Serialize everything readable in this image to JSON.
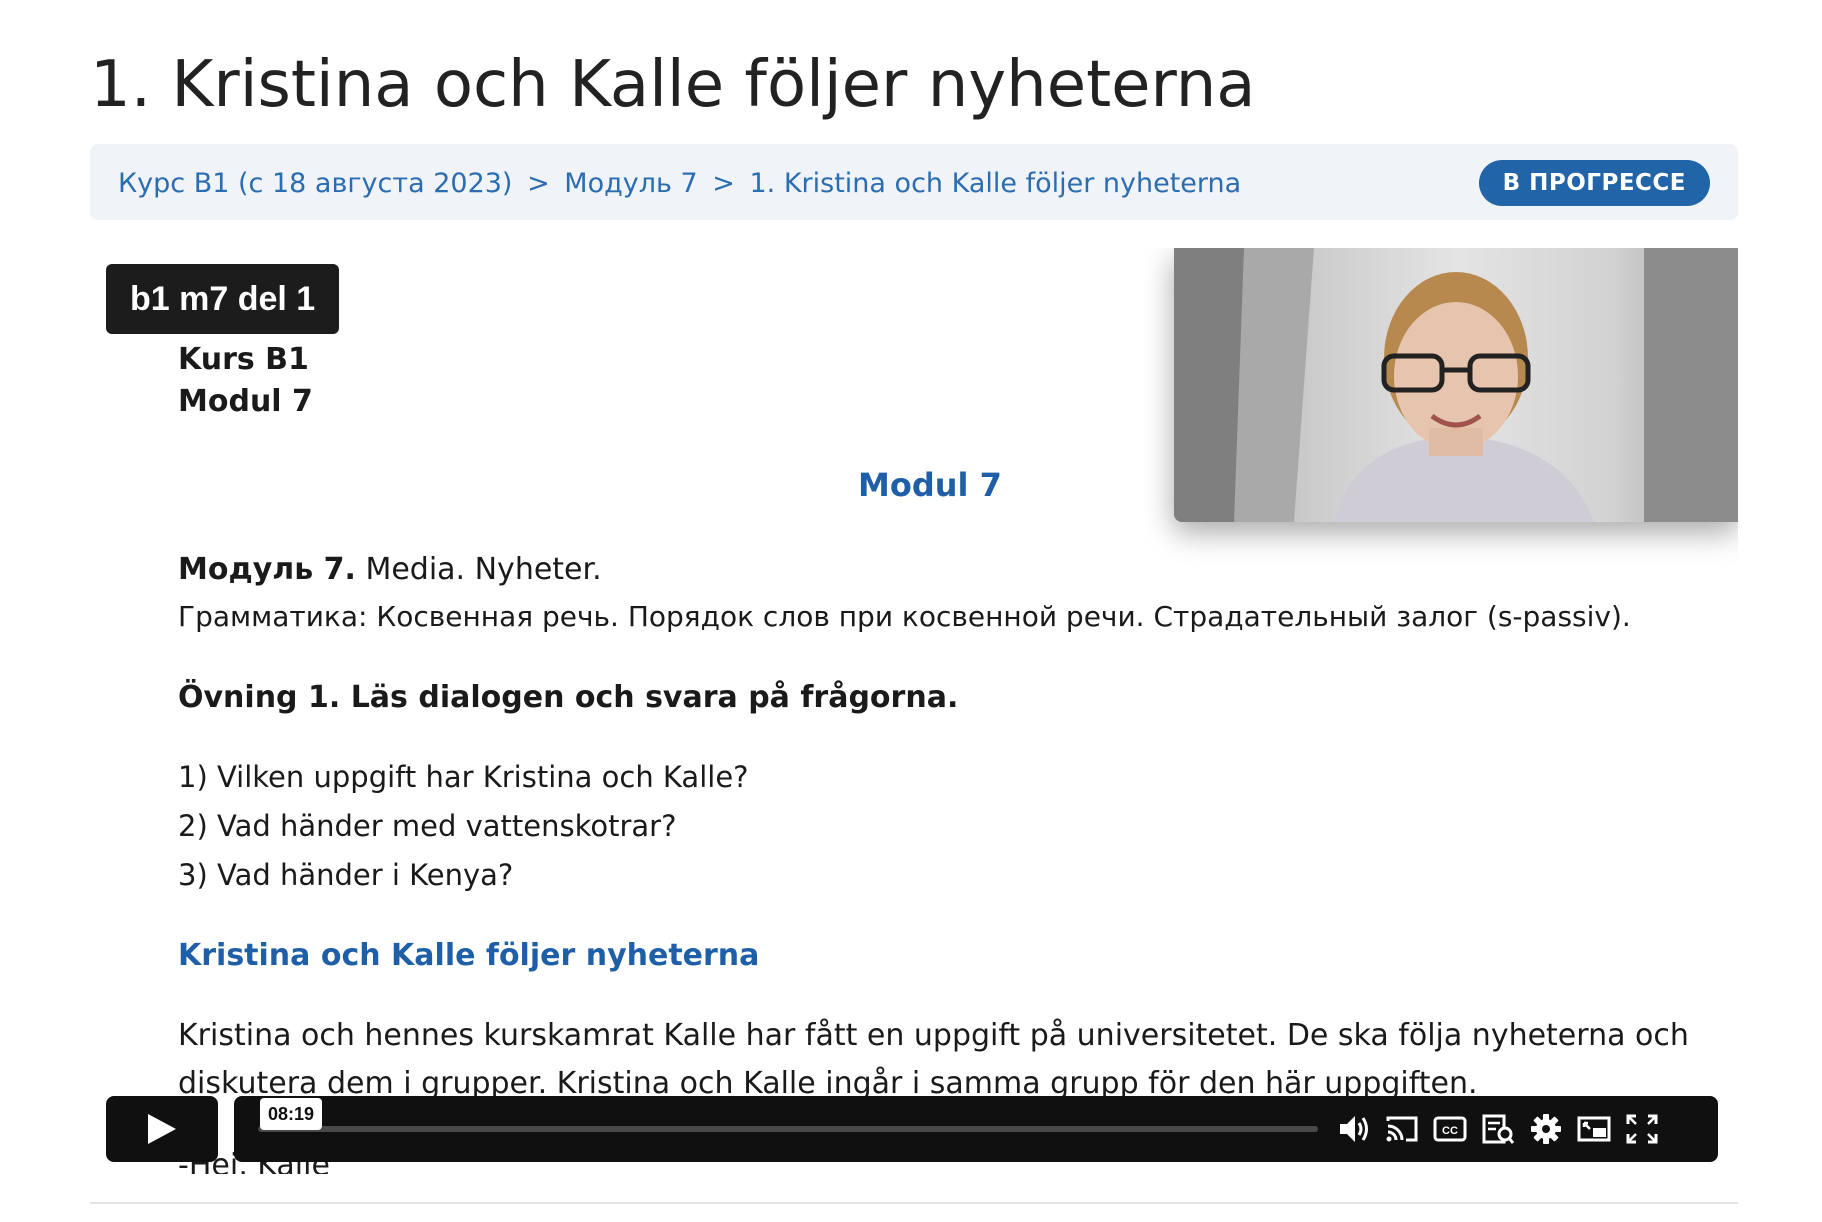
{
  "page": {
    "title": "1. Kristina och Kalle följer nyheterna"
  },
  "breadcrumb": {
    "items": [
      "Курс B1 (с 18 августа 2023)",
      "Модуль 7",
      "1. Kristina och Kalle följer nyheterna"
    ],
    "separator": ">"
  },
  "status_badge": "В ПРОГРЕССЕ",
  "video": {
    "title": "b1 m7 del 1",
    "current_time": "08:19",
    "progress_fraction": 0.0,
    "controls": [
      "play-icon",
      "volume-icon",
      "cast-icon",
      "closed-captions-icon",
      "transcript-icon",
      "settings-gear-icon",
      "picture-in-picture-icon",
      "fullscreen-icon"
    ],
    "document": {
      "kurs": "Kurs B1",
      "modul_left": "Modul 7",
      "modul_center": "Modul 7",
      "module_bold": "Модуль 7.",
      "module_rest": " Media. Nyheter.",
      "grammar": "Грамматика: Косвенная речь. Порядок слов при косвенной речи. Страдательный залог (s-passiv).",
      "exercise": "Övning 1. Läs dialogen och svara på frågorna.",
      "questions": [
        "1) Vilken uppgift har Kristina och Kalle?",
        "2) Vad händer med vattenskotrar?",
        "3) Vad händer i Kenya?"
      ],
      "subheading": "Kristina och Kalle följer nyheterna",
      "paragraph_line1": "Kristina och hennes kurskamrat Kalle har fått en uppgift på universitetet. De ska följa nyheterna och",
      "paragraph_line2": "diskutera dem i grupper. Kristina och Kalle ingår i samma grupp för den här uppgiften.",
      "dialog_start": "-Hej, Kalle"
    }
  },
  "colors": {
    "link_blue": "#2b6db0",
    "badge_blue": "#2264a8",
    "doc_heading_blue": "#1f5fa8",
    "player_bg": "#101010"
  }
}
